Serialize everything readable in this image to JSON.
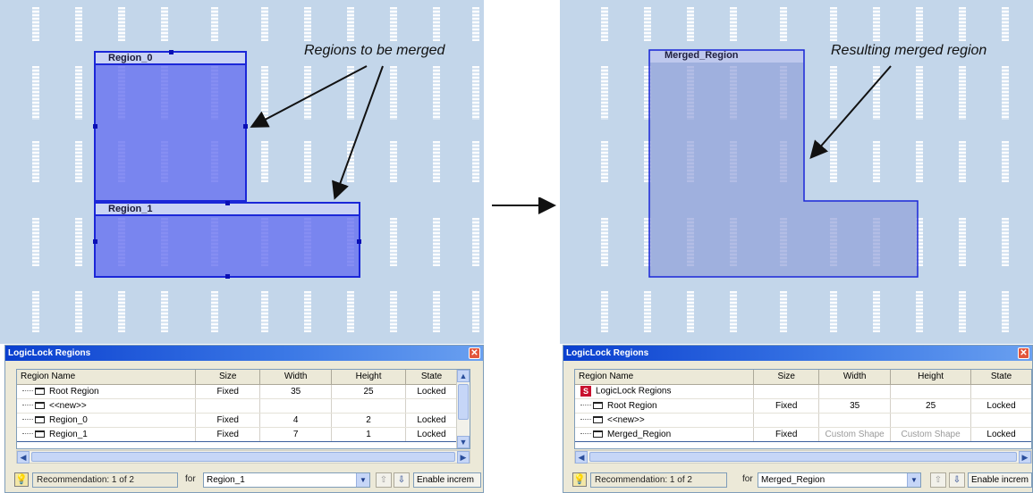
{
  "left": {
    "regions": [
      {
        "name": "Region_0"
      },
      {
        "name": "Region_1"
      }
    ],
    "callout": "Regions to be merged"
  },
  "right": {
    "merged_region_name": "Merged_Region",
    "callout": "Resulting merged region"
  },
  "panel_left": {
    "title": "LogicLock Regions",
    "columns": [
      "Region Name",
      "Size",
      "Width",
      "Height",
      "State"
    ],
    "rows": [
      {
        "name": "Root Region",
        "size": "Fixed",
        "width": "35",
        "height": "25",
        "state": "Locked"
      },
      {
        "name": "<<new>>",
        "size": "",
        "width": "",
        "height": "",
        "state": ""
      },
      {
        "name": "Region_0",
        "size": "Fixed",
        "width": "4",
        "height": "2",
        "state": "Locked"
      },
      {
        "name": "Region_1",
        "size": "Fixed",
        "width": "7",
        "height": "1",
        "state": "Locked"
      }
    ],
    "recommendation": "Recommendation: 1 of 2",
    "for_label": "for",
    "for_value": "Region_1",
    "enable_button": "Enable increm"
  },
  "panel_right": {
    "title": "LogicLock Regions",
    "columns": [
      "Region Name",
      "Size",
      "Width",
      "Height",
      "State"
    ],
    "rows": [
      {
        "name": "LogicLock Regions",
        "size": "",
        "width": "",
        "height": "",
        "state": ""
      },
      {
        "name": "Root Region",
        "size": "Fixed",
        "width": "35",
        "height": "25",
        "state": "Locked"
      },
      {
        "name": "<<new>>",
        "size": "",
        "width": "",
        "height": "",
        "state": ""
      },
      {
        "name": "Merged_Region",
        "size": "Fixed",
        "width": "Custom Shape",
        "height": "Custom Shape",
        "state": "Locked"
      }
    ],
    "recommendation": "Recommendation: 1 of 2",
    "for_label": "for",
    "for_value": "Merged_Region",
    "enable_button": "Enable increm"
  },
  "icons": {
    "close": "close-icon",
    "scroll_up": "scroll-up-icon",
    "scroll_down": "scroll-down-icon",
    "scroll_left": "scroll-left-icon",
    "scroll_right": "scroll-right-icon",
    "dropdown": "chevron-down-icon",
    "region": "region-icon",
    "bulb": "lightbulb-icon",
    "up_arrow": "arrow-up-icon",
    "down_arrow": "arrow-down-icon"
  },
  "colors": {
    "floorplan": "#c3d6ea",
    "region_fill": "#646ef0",
    "region_border": "#1b27d8",
    "merged_fill": "#9aa8d8",
    "titlebar": "#0a3fcf"
  }
}
